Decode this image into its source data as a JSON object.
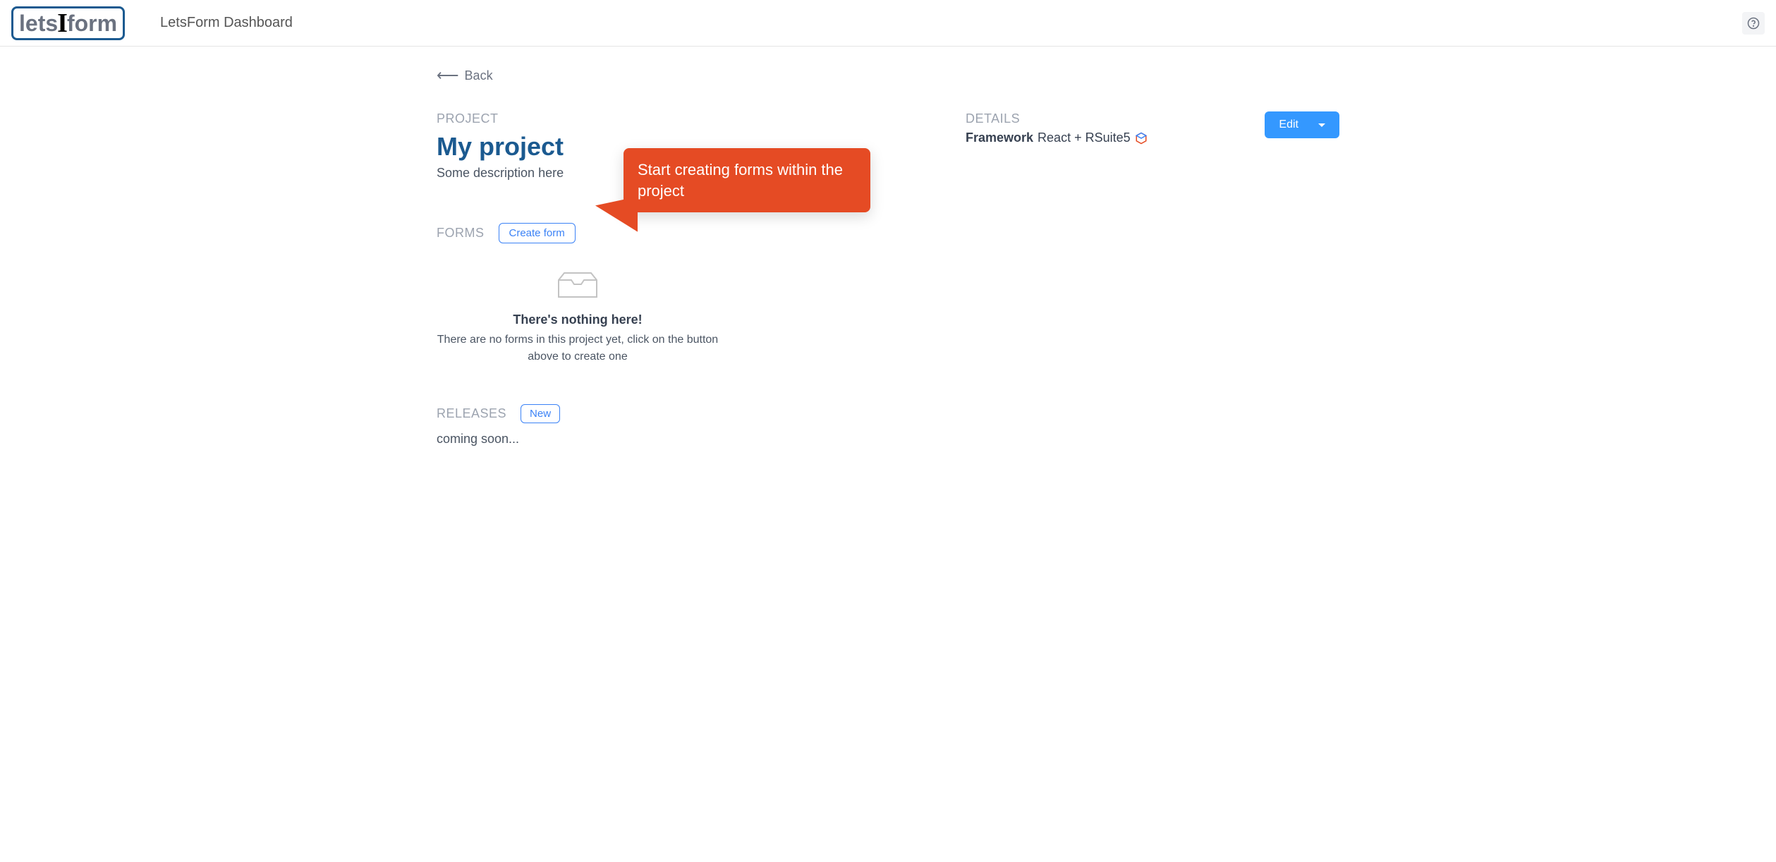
{
  "header": {
    "logo_lets": "lets",
    "logo_cursor": "I",
    "logo_form": "form",
    "title": "LetsForm Dashboard"
  },
  "nav": {
    "back_label": "Back"
  },
  "project": {
    "section_label": "PROJECT",
    "title": "My project",
    "description": "Some description here"
  },
  "forms": {
    "section_label": "FORMS",
    "create_button": "Create form",
    "empty_title": "There's nothing here!",
    "empty_desc": "There are no forms in this project yet, click on the button above to create one"
  },
  "releases": {
    "section_label": "RELEASES",
    "new_button": "New",
    "coming_soon": "coming soon..."
  },
  "details": {
    "section_label": "DETAILS",
    "framework_label": "Framework",
    "framework_value": "React + RSuite5",
    "edit_button": "Edit"
  },
  "callout": {
    "text": "Start creating forms within the project"
  }
}
